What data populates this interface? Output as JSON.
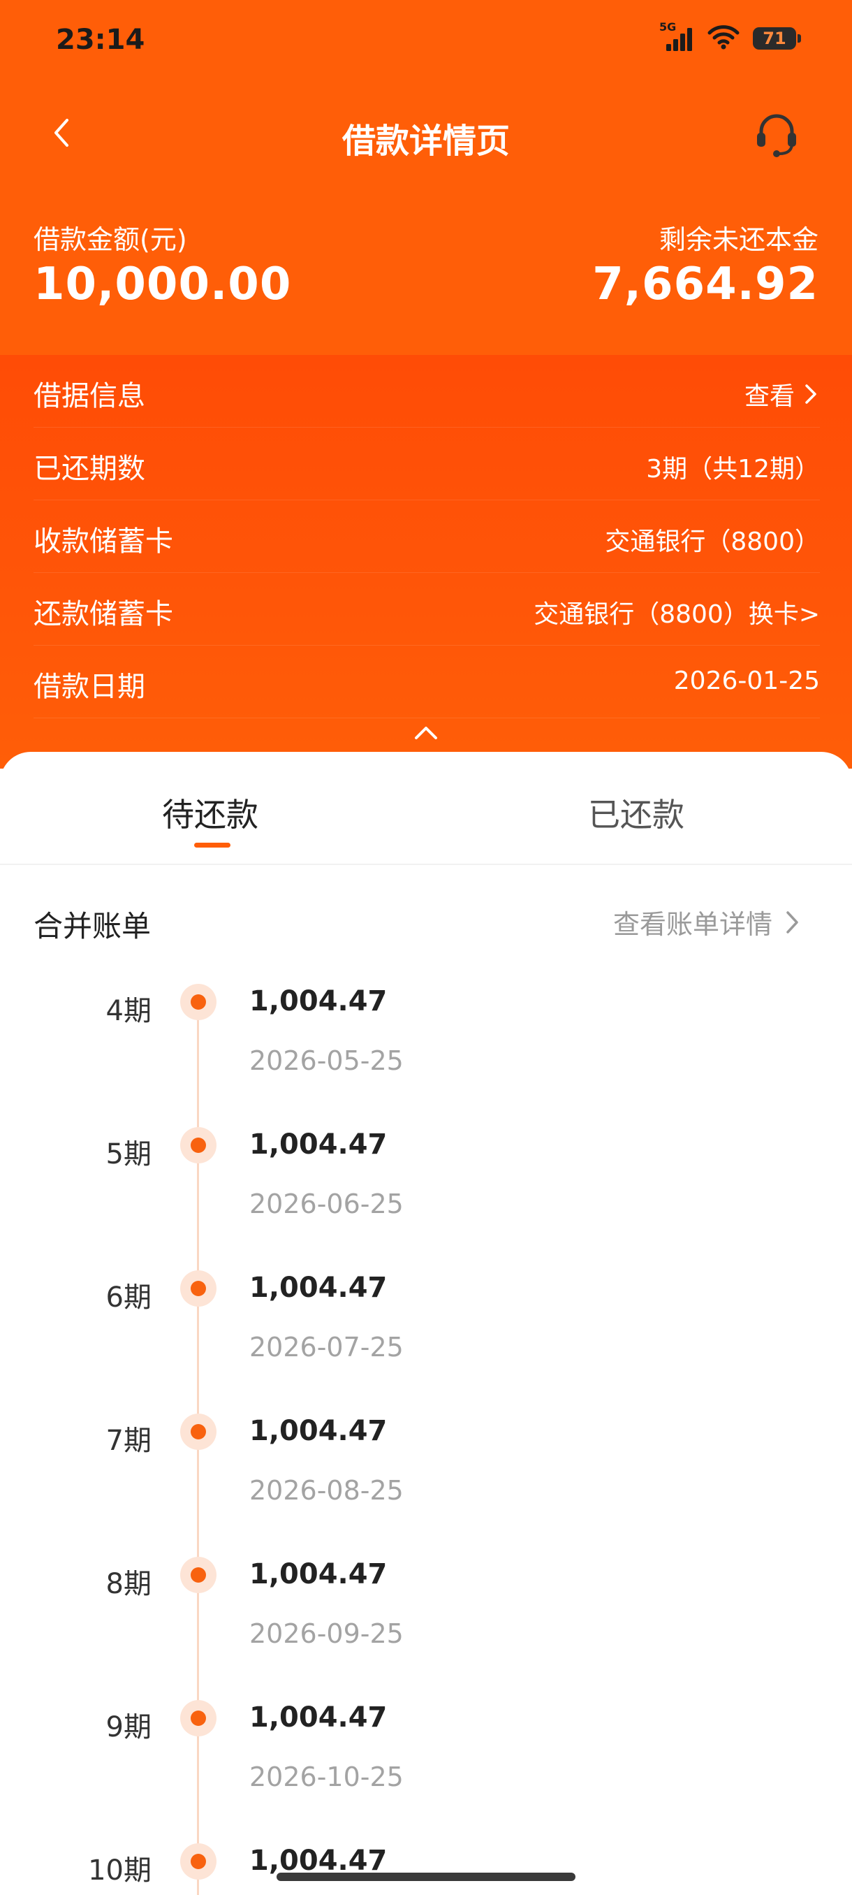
{
  "status_bar": {
    "time": "23:14",
    "network": "5G",
    "battery": "71",
    "icons": [
      "signal-icon",
      "wifi-icon",
      "battery-icon"
    ]
  },
  "header": {
    "title": "借款详情页",
    "icons": [
      "back-arrow-icon",
      "customer-service-headset-icon"
    ]
  },
  "summary": {
    "loan_amount_label": "借款金额(元)",
    "loan_amount": "10,000.00",
    "remaining_label": "剩余未还本金",
    "remaining_amount": "7,664.92"
  },
  "info_rows": [
    {
      "label": "借据信息",
      "value": "查看"
    },
    {
      "label": "已还期数",
      "value": "3期（共12期）"
    },
    {
      "label": "收款储蓄卡",
      "value": "交通银行（8800）"
    },
    {
      "label": "还款储蓄卡",
      "value": "交通银行（8800）换卡>"
    },
    {
      "label": "借款日期",
      "value": "2026-01-25"
    }
  ],
  "tabs": [
    {
      "label": "待还款",
      "active": true
    },
    {
      "label": "已还款",
      "active": false
    }
  ],
  "merged_bill": {
    "title": "合并账单",
    "link": "查看账单详情"
  },
  "bills": [
    {
      "period": "4期",
      "amount": "1,004.47",
      "date": "2026-05-25"
    },
    {
      "period": "5期",
      "amount": "1,004.47",
      "date": "2026-06-25"
    },
    {
      "period": "6期",
      "amount": "1,004.47",
      "date": "2026-07-25"
    },
    {
      "period": "7期",
      "amount": "1,004.47",
      "date": "2026-08-25"
    },
    {
      "period": "8期",
      "amount": "1,004.47",
      "date": "2026-09-25"
    },
    {
      "period": "9期",
      "amount": "1,004.47",
      "date": "2026-10-25"
    },
    {
      "period": "10期",
      "amount": "1,004.47",
      "date": ""
    }
  ],
  "colors": {
    "brand_orange": "#FF5E08",
    "rows_orange": "#FF4C06",
    "timeline_dot": "#F8620F"
  }
}
